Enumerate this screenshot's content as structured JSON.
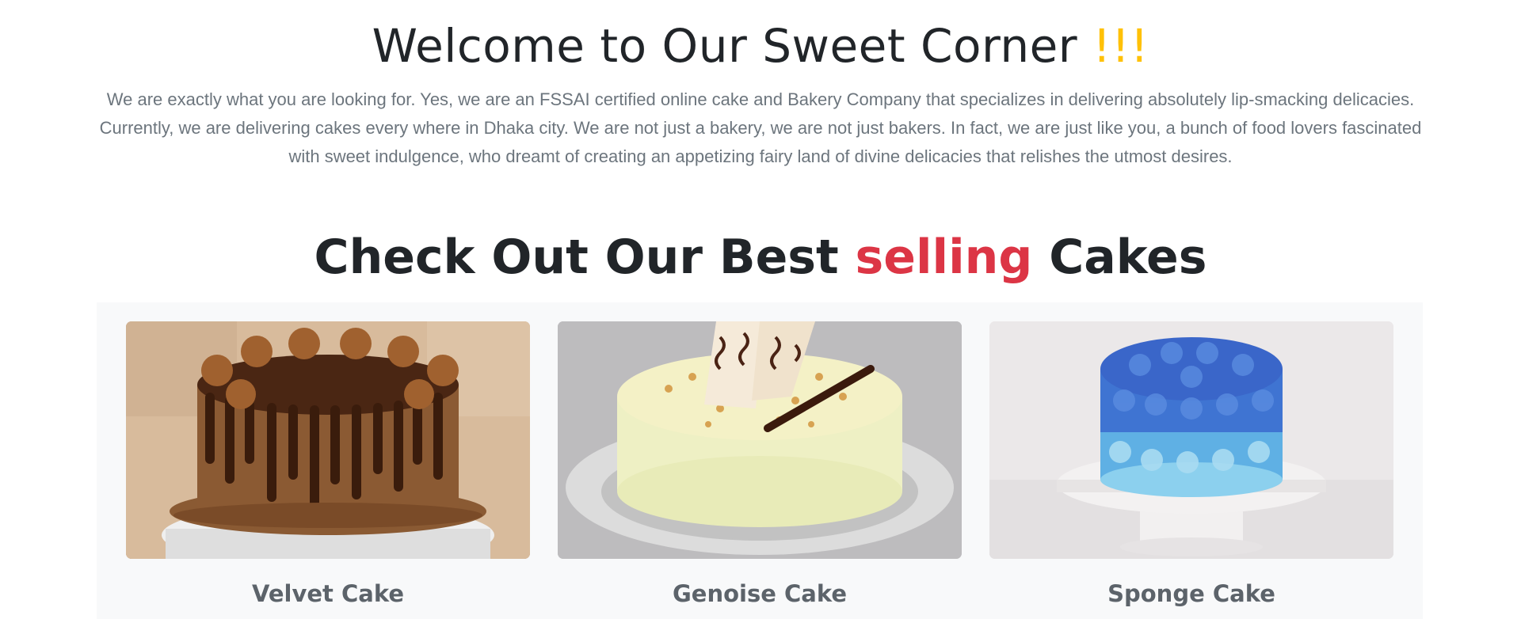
{
  "welcome": {
    "title": "Welcome to Our Sweet Corner",
    "title_accent": "!!!",
    "description": "We are exactly what you are looking for. Yes, we are an FSSAI certified online cake and Bakery Company that specializes in delivering absolutely lip-smacking delicacies. Currently, we are delivering cakes every where in Dhaka city. We are not just a bakery, we are not just bakers. In fact, we are just like you, a bunch of food lovers fascinated with sweet indulgence, who dreamt of creating an appetizing fairy land of divine delicacies that relishes the utmost desires."
  },
  "best_selling": {
    "title_part1": "Check Out Our Best",
    "title_highlight": "selling",
    "title_part2": "Cakes"
  },
  "cards": [
    {
      "name": "Velvet Cake",
      "image": "chocolate-drip-cake-image"
    },
    {
      "name": "Genoise Cake",
      "image": "white-cream-cake-image"
    },
    {
      "name": "Sponge Cake",
      "image": "blue-rosette-cake-image"
    }
  ],
  "colors": {
    "accent_yellow": "#ffc107",
    "highlight_red": "#dc3545",
    "muted_text": "#6c757d",
    "panel_bg": "#f8f9fa"
  }
}
